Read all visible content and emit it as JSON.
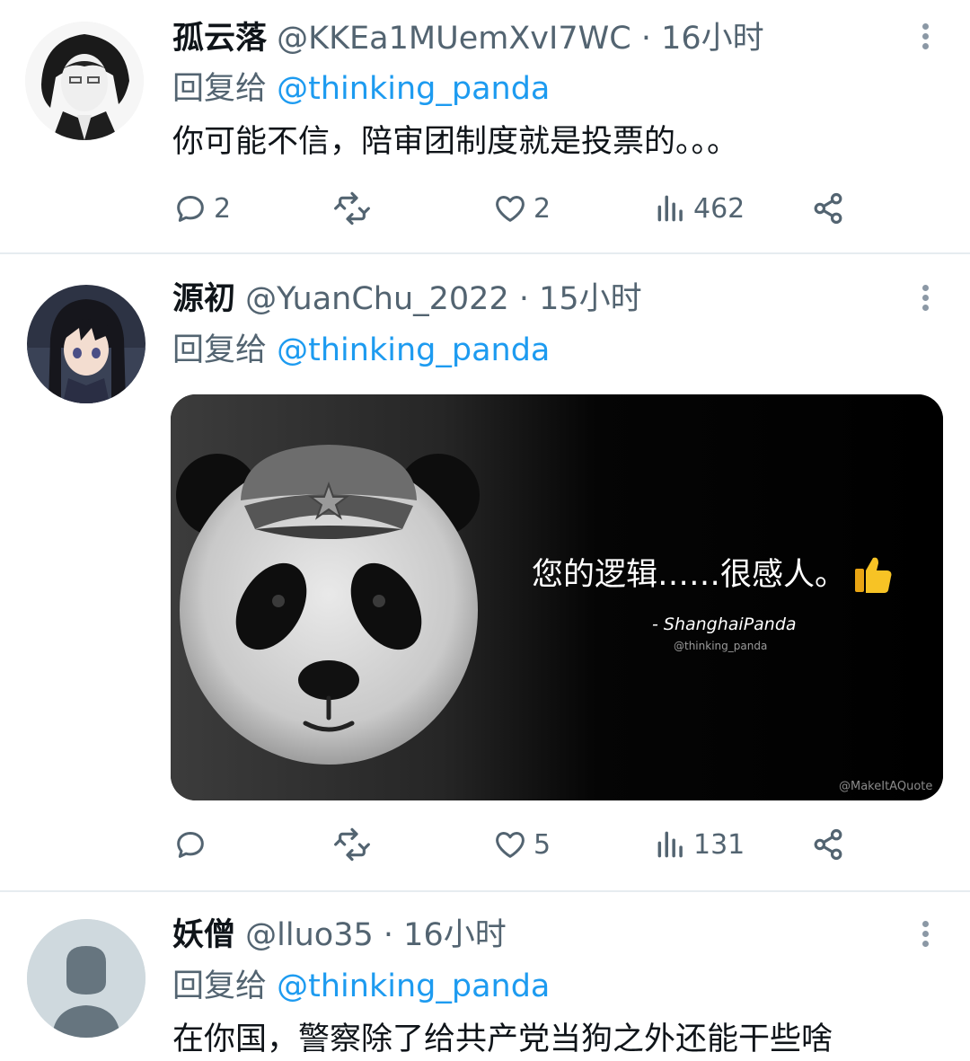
{
  "tweets": [
    {
      "name": "孤云落",
      "handle": "@KKEa1MUemXvI7WC",
      "separator": "·",
      "time": "16小时",
      "reply_prefix": "回复给",
      "reply_to": "@thinking_panda",
      "text": "你可能不信，陪审团制度就是投票的。。。",
      "replies": "2",
      "retweets": "",
      "likes": "2",
      "views": "462"
    },
    {
      "name": "源初",
      "handle": "@YuanChu_2022",
      "separator": "·",
      "time": "15小时",
      "reply_prefix": "回复给",
      "reply_to": "@thinking_panda",
      "media": {
        "quote": "您的逻辑……很感人。",
        "author": "- ShanghaiPanda",
        "author_handle": "@thinking_panda",
        "watermark": "@MakeItAQuote"
      },
      "replies": "",
      "retweets": "",
      "likes": "5",
      "views": "131"
    },
    {
      "name": "妖僧",
      "handle": "@lluo35",
      "separator": "·",
      "time": "16小时",
      "reply_prefix": "回复给",
      "reply_to": "@thinking_panda",
      "text": "在你国，警察除了给共产党当狗之外还能干些啥"
    }
  ],
  "colors": {
    "accent": "#1d9bf0",
    "muted": "#536471",
    "text": "#0f1419",
    "divider": "#e6ecf0"
  },
  "icons": [
    "reply-icon",
    "retweet-icon",
    "like-icon",
    "views-icon",
    "share-icon",
    "more-icon",
    "thumbs-up-icon"
  ]
}
